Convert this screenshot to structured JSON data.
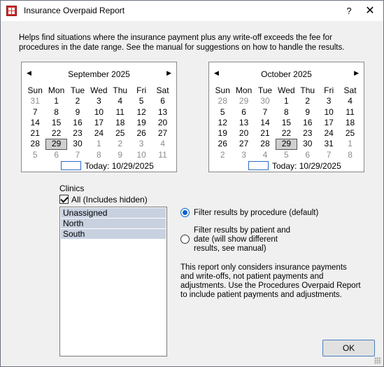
{
  "window": {
    "title": "Insurance Overpaid Report",
    "help": "?",
    "close": "✕"
  },
  "description": "Helps find situations where the insurance payment plus any write-off exceeds the fee for procedures in the date range.  See the manual for suggestions on how to handle the results.",
  "calendars": [
    {
      "month": "September 2025",
      "today_label": "Today: 10/29/2025",
      "weekdays": [
        "Sun",
        "Mon",
        "Tue",
        "Wed",
        "Thu",
        "Fri",
        "Sat"
      ],
      "weeks": [
        [
          {
            "d": "31",
            "o": true
          },
          {
            "d": "1"
          },
          {
            "d": "2"
          },
          {
            "d": "3"
          },
          {
            "d": "4"
          },
          {
            "d": "5"
          },
          {
            "d": "6"
          }
        ],
        [
          {
            "d": "7"
          },
          {
            "d": "8"
          },
          {
            "d": "9"
          },
          {
            "d": "10"
          },
          {
            "d": "11"
          },
          {
            "d": "12"
          },
          {
            "d": "13"
          }
        ],
        [
          {
            "d": "14"
          },
          {
            "d": "15"
          },
          {
            "d": "16"
          },
          {
            "d": "17"
          },
          {
            "d": "18"
          },
          {
            "d": "19"
          },
          {
            "d": "20"
          }
        ],
        [
          {
            "d": "21"
          },
          {
            "d": "22"
          },
          {
            "d": "23"
          },
          {
            "d": "24"
          },
          {
            "d": "25"
          },
          {
            "d": "26"
          },
          {
            "d": "27"
          }
        ],
        [
          {
            "d": "28"
          },
          {
            "d": "29",
            "sel": true
          },
          {
            "d": "30"
          },
          {
            "d": "1",
            "o": true
          },
          {
            "d": "2",
            "o": true
          },
          {
            "d": "3",
            "o": true
          },
          {
            "d": "4",
            "o": true
          }
        ],
        [
          {
            "d": "5",
            "o": true
          },
          {
            "d": "6",
            "o": true
          },
          {
            "d": "7",
            "o": true
          },
          {
            "d": "8",
            "o": true
          },
          {
            "d": "9",
            "o": true
          },
          {
            "d": "10",
            "o": true
          },
          {
            "d": "11",
            "o": true
          }
        ]
      ]
    },
    {
      "month": "October 2025",
      "today_label": "Today: 10/29/2025",
      "weekdays": [
        "Sun",
        "Mon",
        "Tue",
        "Wed",
        "Thu",
        "Fri",
        "Sat"
      ],
      "weeks": [
        [
          {
            "d": "28",
            "o": true
          },
          {
            "d": "29",
            "o": true
          },
          {
            "d": "30",
            "o": true
          },
          {
            "d": "1"
          },
          {
            "d": "2"
          },
          {
            "d": "3"
          },
          {
            "d": "4"
          }
        ],
        [
          {
            "d": "5"
          },
          {
            "d": "6"
          },
          {
            "d": "7"
          },
          {
            "d": "8"
          },
          {
            "d": "9"
          },
          {
            "d": "10"
          },
          {
            "d": "11"
          }
        ],
        [
          {
            "d": "12"
          },
          {
            "d": "13"
          },
          {
            "d": "14"
          },
          {
            "d": "15"
          },
          {
            "d": "16"
          },
          {
            "d": "17"
          },
          {
            "d": "18"
          }
        ],
        [
          {
            "d": "19"
          },
          {
            "d": "20"
          },
          {
            "d": "21"
          },
          {
            "d": "22"
          },
          {
            "d": "23"
          },
          {
            "d": "24"
          },
          {
            "d": "25"
          }
        ],
        [
          {
            "d": "26"
          },
          {
            "d": "27"
          },
          {
            "d": "28"
          },
          {
            "d": "29",
            "sel": true
          },
          {
            "d": "30"
          },
          {
            "d": "31"
          },
          {
            "d": "1",
            "o": true
          }
        ],
        [
          {
            "d": "2",
            "o": true
          },
          {
            "d": "3",
            "o": true
          },
          {
            "d": "4",
            "o": true
          },
          {
            "d": "5",
            "o": true
          },
          {
            "d": "6",
            "o": true
          },
          {
            "d": "7",
            "o": true
          },
          {
            "d": "8",
            "o": true
          }
        ]
      ]
    }
  ],
  "clinics": {
    "label": "Clinics",
    "all_label": "All (Includes hidden)",
    "all_checked": true,
    "items": [
      "Unassigned",
      "North",
      "South"
    ]
  },
  "filter": {
    "option1": "Filter results by procedure (default)",
    "option2": "Filter results by patient and date (will show different results, see manual)",
    "selected": "option1"
  },
  "note": "This report only considers insurance payments and write-offs, not patient payments and adjustments. Use the Procedures Overpaid Report to include patient payments and adjustments.",
  "ok_label": "OK",
  "colors": {
    "selection": "#c8d1e0",
    "accent": "#0a64c8",
    "background": "#f0f0f0"
  }
}
